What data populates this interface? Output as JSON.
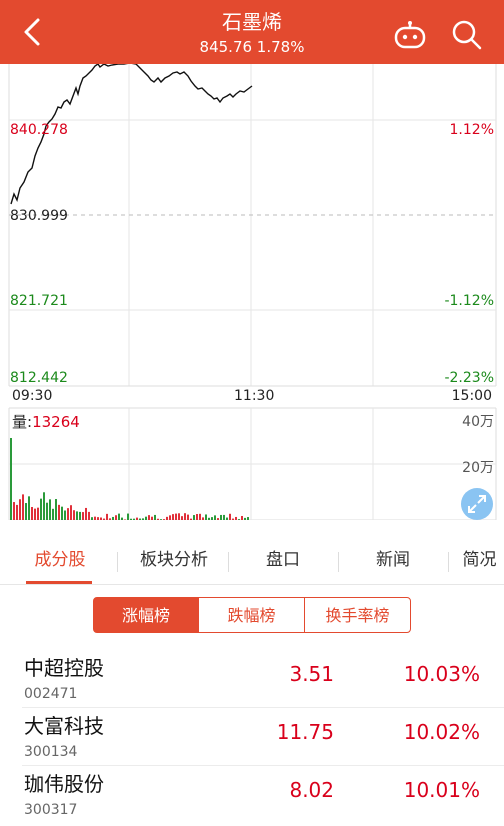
{
  "header": {
    "title": "石墨烯",
    "quote": "845.76 1.78%",
    "back_icon": "chevron-left-icon",
    "robot_icon": "robot-icon",
    "search_icon": "search-icon"
  },
  "chart": {
    "price_labels": [
      "840.278",
      "830.999",
      "821.721",
      "812.442"
    ],
    "pct_labels": [
      "1.12%",
      "-1.12%",
      "-2.23%"
    ],
    "time_labels": [
      "09:30",
      "11:30",
      "15:00"
    ],
    "volume_caption": "量:",
    "volume_value": "13264",
    "volume_axis": [
      "40万",
      "20万"
    ],
    "expand_icon": "expand-icon"
  },
  "tabs": [
    "成分股",
    "板块分析",
    "盘口",
    "新闻",
    "简况"
  ],
  "segments": [
    "涨幅榜",
    "跌幅榜",
    "换手率榜"
  ],
  "stocks": [
    {
      "name": "中超控股",
      "code": "002471",
      "price": "3.51",
      "pct": "10.03%"
    },
    {
      "name": "大富科技",
      "code": "300134",
      "price": "11.75",
      "pct": "10.02%"
    },
    {
      "name": "珈伟股份",
      "code": "300317",
      "price": "8.02",
      "pct": "10.01%"
    }
  ],
  "colors": {
    "accent": "#e34a2f",
    "up": "#d9001b",
    "down": "#1c8a1c"
  }
}
